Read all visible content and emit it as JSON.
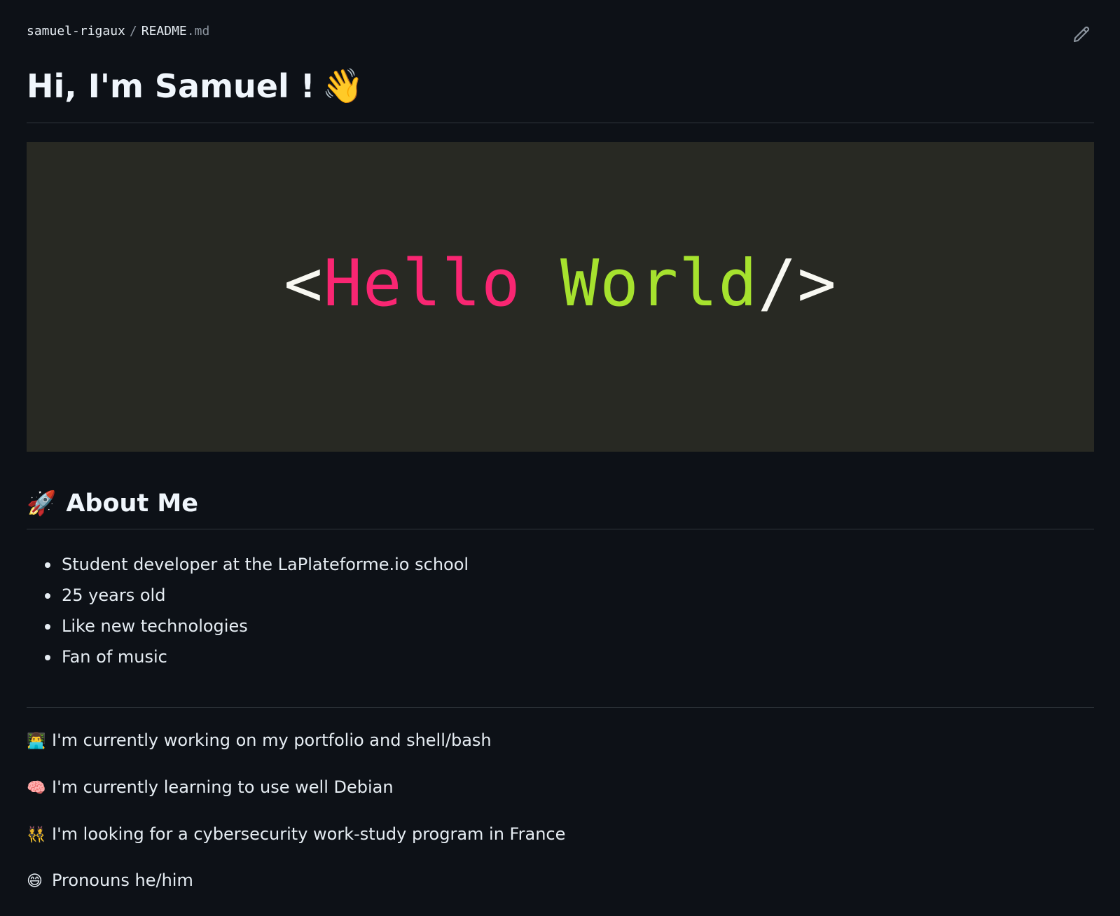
{
  "header": {
    "owner": "samuel-rigaux",
    "separator": "/",
    "file_name": "README",
    "file_ext": ".md",
    "edit_icon": "pencil-icon"
  },
  "readme": {
    "title": "Hi, I'm Samuel !",
    "title_emoji": "👋",
    "banner": {
      "open": "<",
      "word1": "Hello",
      "word2": "World",
      "close": "/>",
      "colors": {
        "bracket": "#f8f8f2",
        "word1": "#f92672",
        "word2": "#a6e22e",
        "background": "#282923"
      }
    },
    "about": {
      "emoji": "🚀",
      "heading": "About Me",
      "items": [
        "Student developer at the LaPlateforme.io school",
        "25 years old",
        "Like new technologies",
        "Fan of music"
      ]
    },
    "status": [
      {
        "emoji": "👨‍💻",
        "text": "I'm currently working on my portfolio and shell/bash"
      },
      {
        "emoji": "🧠",
        "text": "I'm currently learning to use well Debian"
      },
      {
        "emoji": "👯",
        "text": "I'm looking for a cybersecurity work-study program in France"
      },
      {
        "emoji": "😄",
        "text": "Pronouns he/him"
      }
    ]
  }
}
